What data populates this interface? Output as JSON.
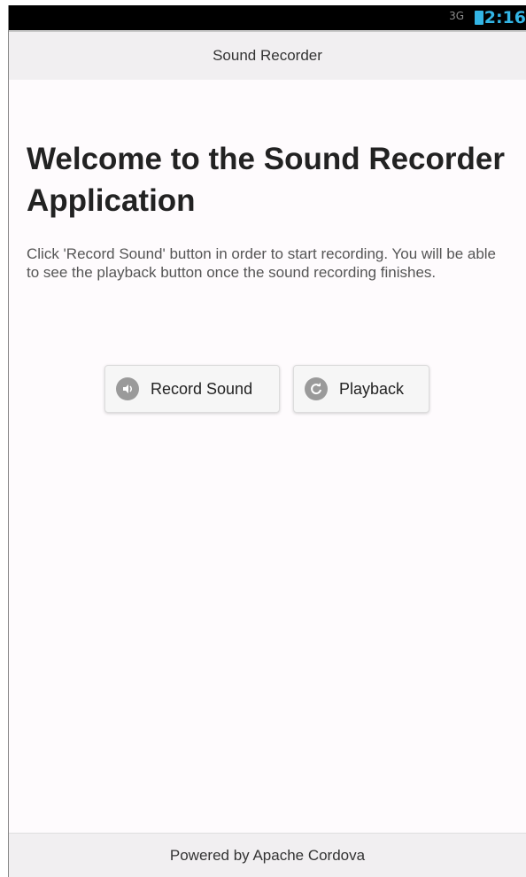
{
  "status_bar": {
    "signal_label": "3G",
    "signal_icon": "signal-icon",
    "battery_icon": "battery-icon",
    "time": "2:16"
  },
  "header": {
    "title": "Sound Recorder"
  },
  "main": {
    "heading": "Welcome to the Sound Recorder Application",
    "description": "Click 'Record Sound' button in order to start recording. You will be able to see the playback button once the sound recording finishes."
  },
  "buttons": {
    "record": {
      "label": "Record Sound",
      "icon": "speaker-icon"
    },
    "playback": {
      "label": "Playback",
      "icon": "refresh-icon"
    }
  },
  "footer": {
    "text": "Powered by Apache Cordova"
  },
  "colors": {
    "status_accent": "#33b5e5",
    "bar_background": "#f1eff1",
    "page_background": "#fefbfd"
  }
}
